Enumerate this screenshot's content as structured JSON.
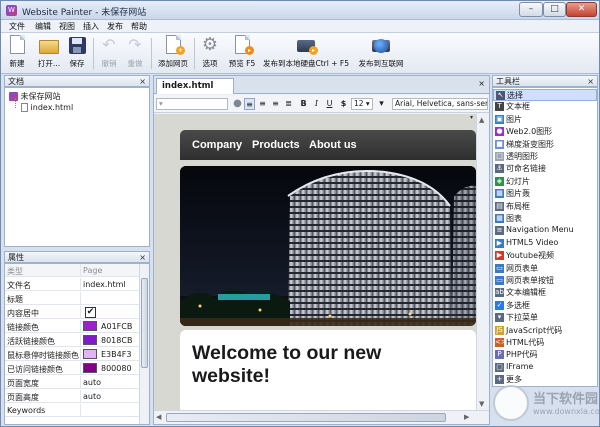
{
  "window": {
    "title": "Website Painter - 未保存网站",
    "app_glyph": "W"
  },
  "menu": [
    "文件",
    "编辑",
    "视图",
    "插入",
    "发布",
    "帮助"
  ],
  "toolbar": {
    "new": "新建",
    "open": "打开...",
    "save": "保存",
    "undo": "撤销",
    "redo": "重做",
    "add_page": "添加网页",
    "options": "选项",
    "preview": "预览 F5",
    "publish_local": "发布到本地硬盘Ctrl + F5",
    "publish_web": "发布到互联网"
  },
  "document_pane": {
    "title": "文档",
    "close": "×",
    "site": "未保存网站",
    "file": "index.html"
  },
  "properties_pane": {
    "title": "属性",
    "close": "×",
    "rows": [
      {
        "key": "类型",
        "value": "Page"
      },
      {
        "key": "文件名",
        "value": "index.html"
      },
      {
        "key": "标题",
        "value": ""
      },
      {
        "key": "内容居中",
        "value": "✔"
      },
      {
        "key": "链接颜色",
        "value": "A01FCB",
        "color": "#A01FCB"
      },
      {
        "key": "活跃链接颜色",
        "value": "8018CB",
        "color": "#8018CB"
      },
      {
        "key": "鼠标悬停时链接颜色",
        "value": "E3B4F3",
        "color": "#E3B4F3"
      },
      {
        "key": "已访问链接颜色",
        "value": "800080",
        "color": "#800080"
      },
      {
        "key": "页面宽度",
        "value": "auto"
      },
      {
        "key": "页面高度",
        "value": "auto"
      },
      {
        "key": "Keywords",
        "value": ""
      }
    ]
  },
  "editor": {
    "tab": "index.html",
    "format": {
      "size": "12",
      "font": "Arial, Helvetica, sans-serif"
    },
    "page": {
      "nav": [
        "Company",
        "Products",
        "About us"
      ],
      "welcome": "Welcome to our new website!"
    }
  },
  "toolbox": {
    "title": "工具栏",
    "close": "×",
    "items": [
      {
        "label": "选择",
        "icon": "pointer-icon",
        "glyph": "↖",
        "color": "#4d5a6e"
      },
      {
        "label": "文本框",
        "icon": "text-icon",
        "glyph": "T",
        "color": "#444444"
      },
      {
        "label": "图片",
        "icon": "image-icon",
        "glyph": "▣",
        "color": "#3c7dc4"
      },
      {
        "label": "Web2.0图形",
        "icon": "web20-shape-icon",
        "glyph": "●",
        "color": "#9b2fc9"
      },
      {
        "label": "梯度渐变图形",
        "icon": "gradient-shape-icon",
        "glyph": "■",
        "color": "#6c8fd6"
      },
      {
        "label": "透明图形",
        "icon": "transparent-shape-icon",
        "glyph": "□",
        "color": "#9aa4b2"
      },
      {
        "label": "可命名链接",
        "icon": "anchor-icon",
        "glyph": "⚓",
        "color": "#5b6a80"
      },
      {
        "label": "幻灯片",
        "icon": "slideshow-icon",
        "glyph": "◈",
        "color": "#2f8f4f"
      },
      {
        "label": "图片轰",
        "icon": "gallery-icon",
        "glyph": "▦",
        "color": "#3c7dc4"
      },
      {
        "label": "布局框",
        "icon": "layout-box-icon",
        "glyph": "▤",
        "color": "#5b6a80"
      },
      {
        "label": "图表",
        "icon": "table-icon",
        "glyph": "▦",
        "color": "#3a7bc8"
      },
      {
        "label": "Navigation Menu",
        "icon": "nav-menu-icon",
        "glyph": "≡",
        "color": "#5b6a80"
      },
      {
        "label": "HTML5 Video",
        "icon": "video-icon",
        "glyph": "▶",
        "color": "#3a7bc8"
      },
      {
        "label": "Youtube视频",
        "icon": "youtube-icon",
        "glyph": "▶",
        "color": "#d33a2c"
      },
      {
        "label": "网页表单",
        "icon": "form-icon",
        "glyph": "▭",
        "color": "#3a7bc8"
      },
      {
        "label": "网页表单按钮",
        "icon": "form-button-icon",
        "glyph": "▭",
        "color": "#3a7bc8"
      },
      {
        "label": "文本编辑框",
        "icon": "textarea-icon",
        "glyph": "ab",
        "color": "#5b6a80"
      },
      {
        "label": "多选框",
        "icon": "checkbox-icon",
        "glyph": "✓",
        "color": "#2b7bd8"
      },
      {
        "label": "下拉菜单",
        "icon": "dropdown-icon",
        "glyph": "▾",
        "color": "#5b6a80"
      },
      {
        "label": "JavaScript代码",
        "icon": "javascript-icon",
        "glyph": "JS",
        "color": "#d3a12c"
      },
      {
        "label": "HTML代码",
        "icon": "html-icon",
        "glyph": "<>",
        "color": "#d35a2c"
      },
      {
        "label": "PHP代码",
        "icon": "php-icon",
        "glyph": "P",
        "color": "#6a6fb0"
      },
      {
        "label": "IFrame",
        "icon": "iframe-icon",
        "glyph": "▢",
        "color": "#5b6a80"
      },
      {
        "label": "更多",
        "icon": "more-icon",
        "glyph": "+",
        "color": "#5b6a80"
      }
    ]
  },
  "watermark": {
    "name": "当下软件园",
    "url": "www.downxia.com"
  },
  "colors": {
    "accent": "#A01FCB",
    "nav_bar": "#3a3a3a"
  }
}
